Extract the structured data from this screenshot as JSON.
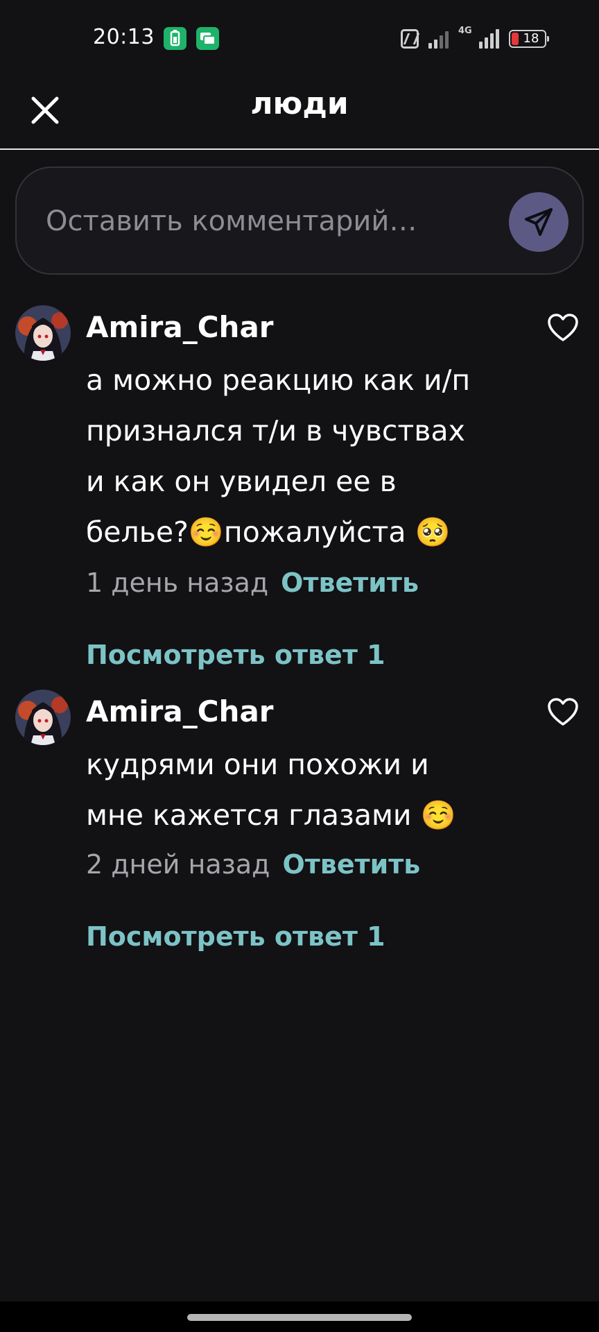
{
  "status_bar": {
    "time": "20:13",
    "battery_level": "18",
    "network": "4G"
  },
  "header": {
    "title": "люди"
  },
  "comment_input": {
    "placeholder": "Оставить комментарий…"
  },
  "comments": [
    {
      "author": "Amira_Char",
      "text": "а можно реакцию  как и/п признался т/и в чувствах и как он увидел ее в белье?☺️пожалуйста 🥺",
      "time": "1 день назад",
      "reply_label": "Ответить",
      "view_replies_label": "Посмотреть ответ 1"
    },
    {
      "author": "Amira_Char",
      "text": "кудрями они похожи и мне кажется глазами ☺️",
      "time": "2 дней назад",
      "reply_label": "Ответить",
      "view_replies_label": "Посмотреть ответ 1"
    }
  ],
  "colors": {
    "background": "#121114",
    "accent": "#7cc3c6",
    "send_button": "#5c5a85",
    "battery_low": "#e5383b"
  }
}
